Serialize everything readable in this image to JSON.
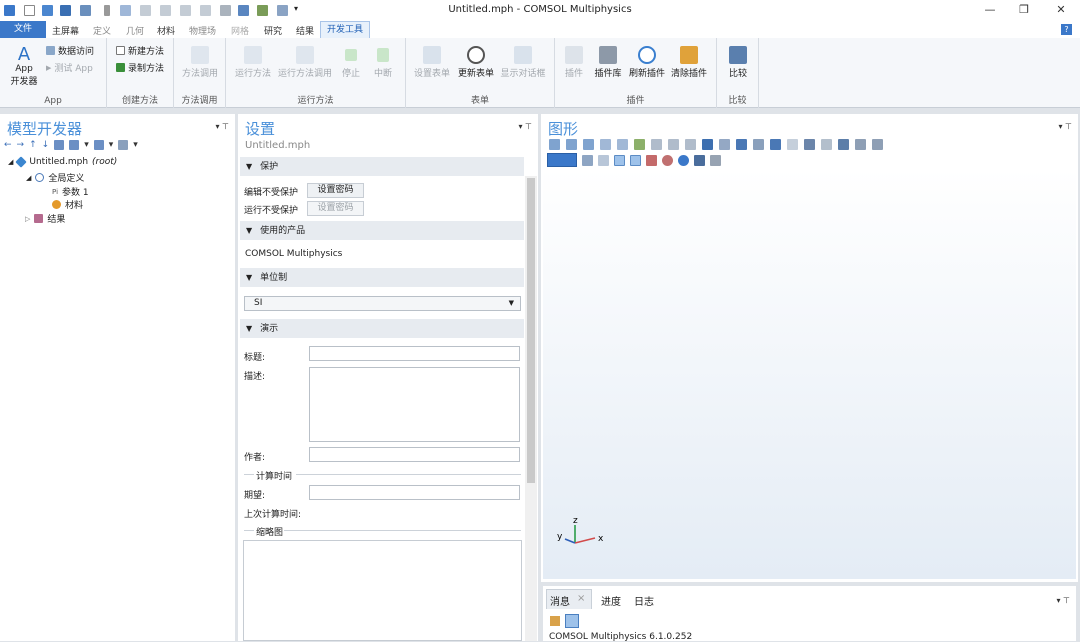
{
  "titlebar": {
    "title": "Untitled.mph - COMSOL Multiphysics",
    "minimize": "—",
    "maximize": "❐",
    "close": "✕"
  },
  "tabs": {
    "file": "文件",
    "home": "主屏幕",
    "definitions": "定义",
    "geometry": "几何",
    "materials": "材料",
    "physics": "物理场",
    "study": "研究",
    "results": "结果",
    "developer": "开发工具",
    "help": "?"
  },
  "ribbon": {
    "app": {
      "app_btn_line1": "App",
      "app_btn_line2": "开发器",
      "data_access": "数据访问",
      "test_app": "测试 App",
      "group": "App"
    },
    "create_method": {
      "new_method": "新建方法",
      "record_method": "录制方法",
      "group": "创建方法"
    },
    "method_call": {
      "method_call": "方法调用",
      "group": "方法调用"
    },
    "run_method": {
      "run_method": "运行方法",
      "run_method_call": "运行方法调用",
      "stop": "停止",
      "pause": "中断",
      "group": "运行方法"
    },
    "form": {
      "set_form": "设置表单",
      "refresh_form": "更新表单",
      "show_dialog": "显示对话框",
      "group": "表单"
    },
    "addin": {
      "addin": "插件",
      "addin_lib": "插件库",
      "refresh_addin": "刷新插件",
      "clear_addin": "清除插件",
      "group": "插件"
    },
    "compare": {
      "compare": "比较",
      "group": "比较"
    }
  },
  "model_builder": {
    "title": "模型开发器",
    "pin": "▾ ⊤",
    "tree": [
      {
        "label": "Untitled.mph",
        "suffix": "(root)"
      },
      {
        "label": "全局定义"
      },
      {
        "label": "参数 1"
      },
      {
        "label": "材料"
      },
      {
        "label": "结果"
      }
    ]
  },
  "settings": {
    "title": "设置",
    "subtitle": "Untitled.mph",
    "protection": {
      "header": "保护",
      "edit_label": "编辑不受保护",
      "run_label": "运行不受保护",
      "set_pwd": "设置密码",
      "set_pwd2": "设置密码"
    },
    "products": {
      "header": "使用的产品",
      "item": "COMSOL Multiphysics"
    },
    "units": {
      "header": "单位制",
      "value": "SI"
    },
    "presentation": {
      "header": "演示",
      "title_label": "标题:",
      "desc_label": "描述:",
      "author_label": "作者:",
      "calc_time": "计算时间",
      "expected_label": "期望:",
      "last_calc_label": "上次计算时间:",
      "thumbnail": "缩略图"
    }
  },
  "graphics": {
    "title": "图形",
    "axis_z": "z",
    "axis_y": "y",
    "axis_x": "x"
  },
  "messages": {
    "tab_msg": "消息",
    "tab_close": "×",
    "tab_progress": "进度",
    "tab_log": "日志",
    "line": "COMSOL Multiphysics 6.1.0.252"
  }
}
